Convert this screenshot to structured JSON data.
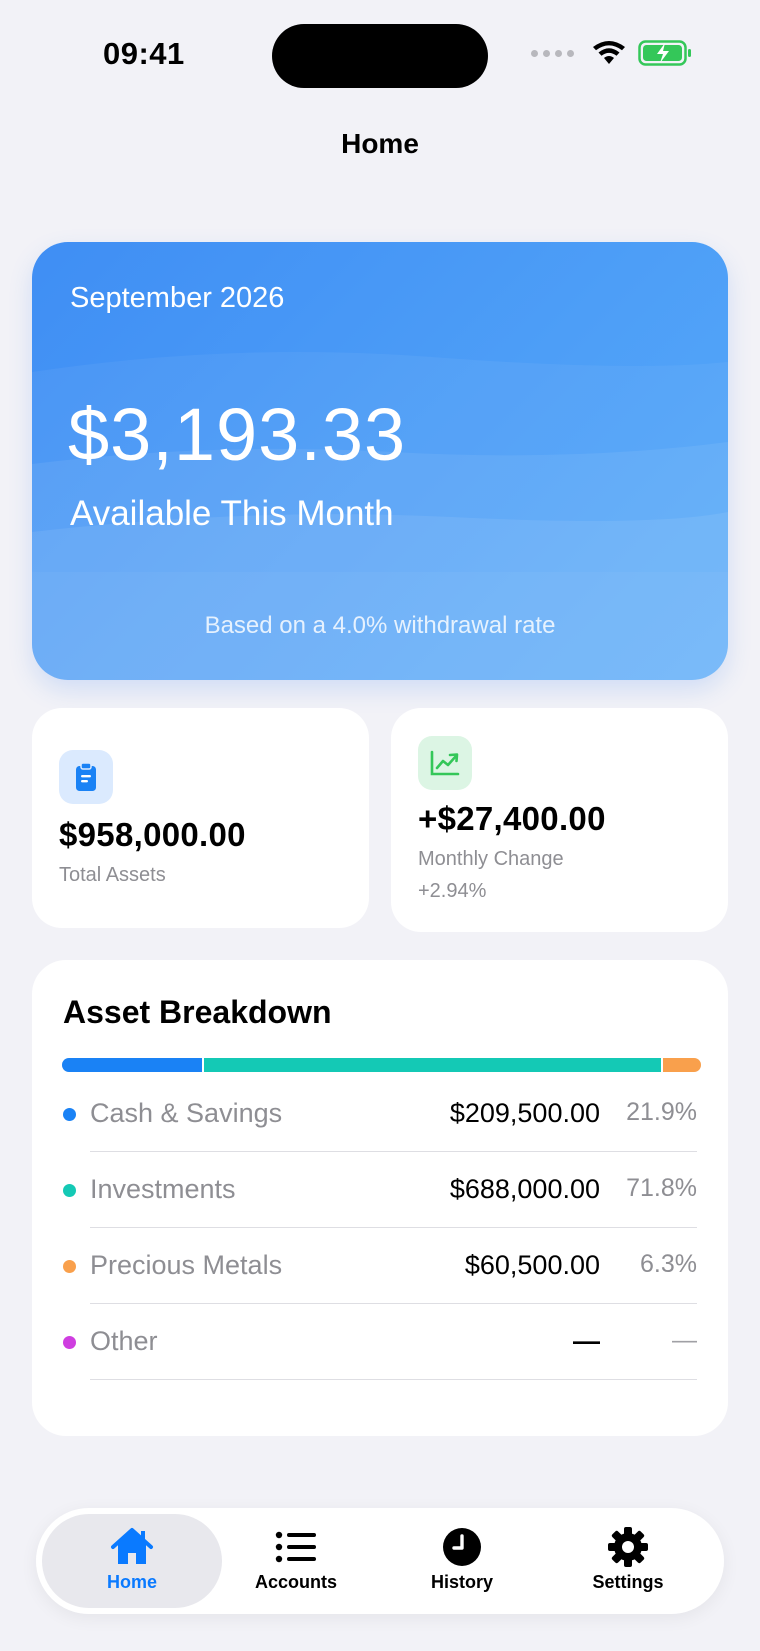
{
  "status_bar": {
    "time": "09:41"
  },
  "nav": {
    "title": "Home"
  },
  "hero": {
    "month": "September 2026",
    "amount": "$3,193.33",
    "label": "Available This Month",
    "note": "Based on a 4.0% withdrawal rate"
  },
  "stats": {
    "total_assets": {
      "value": "$958,000.00",
      "label": "Total Assets",
      "icon": "clipboard-icon"
    },
    "monthly_change": {
      "value": "+$27,400.00",
      "label": "Monthly Change",
      "sub": "+2.94%",
      "icon": "trend-up-icon"
    }
  },
  "breakdown": {
    "title": "Asset Breakdown",
    "items": [
      {
        "name": "Cash & Savings",
        "value": "$209,500.00",
        "pct": "21.9%",
        "share": 21.9,
        "color": "#1a82f5"
      },
      {
        "name": "Investments",
        "value": "$688,000.00",
        "pct": "71.8%",
        "share": 71.8,
        "color": "#14c9b5"
      },
      {
        "name": "Precious Metals",
        "value": "$60,500.00",
        "pct": "6.3%",
        "share": 6.3,
        "color": "#f9a04c"
      },
      {
        "name": "Other",
        "value": "—",
        "pct": "—",
        "share": 0,
        "color": "#cf3ee0"
      }
    ]
  },
  "tabs": [
    {
      "label": "Home",
      "icon": "house-icon",
      "active": true
    },
    {
      "label": "Accounts",
      "icon": "list-icon",
      "active": false
    },
    {
      "label": "History",
      "icon": "clock-icon",
      "active": false
    },
    {
      "label": "Settings",
      "icon": "gear-icon",
      "active": false
    }
  ],
  "colors": {
    "accent": "#0a7aff",
    "hero_start": "#3f8ef4",
    "hero_end": "#57aaf9",
    "positive": "#34c759"
  }
}
